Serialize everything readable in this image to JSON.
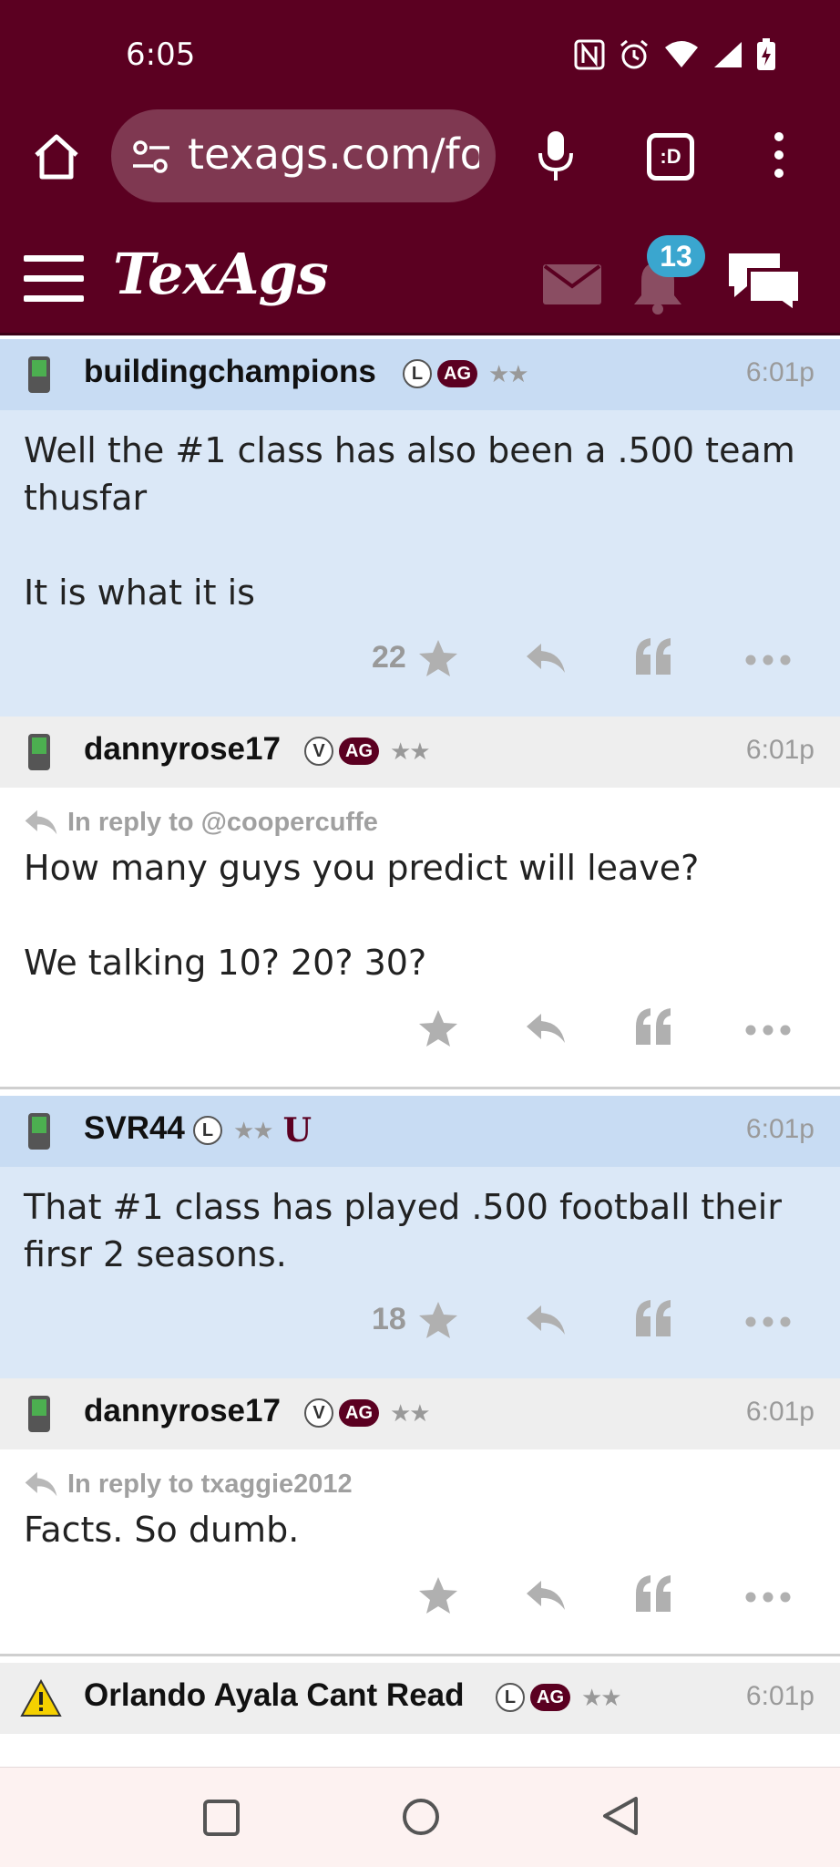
{
  "status_bar": {
    "time": "6:05",
    "icons": [
      "nfc-icon",
      "alarm-icon",
      "wifi-icon",
      "signal-icon",
      "battery-charging-icon"
    ]
  },
  "browser": {
    "url_main": "texags.com/for",
    "tabs_label": ":D"
  },
  "site": {
    "logo": "TexAgs",
    "notifications_count": "13"
  },
  "colors": {
    "maroon": "#5b0021",
    "highlight_body": "#dbe8f7",
    "highlight_head": "#c8dcf3",
    "badge_blue": "#3aa6cf"
  },
  "posts": [
    {
      "username": "buildingchampions",
      "badge_letter": "L",
      "badge_ag": "AG",
      "stars": "★★",
      "time": "6:01p",
      "line1": "Well the #1 class has also been a .500 team thusfar",
      "line2": "It is what it is",
      "star_count": "22"
    },
    {
      "username": "dannyrose17",
      "badge_letter": "V",
      "badge_ag": "AG",
      "stars": "★★",
      "time": "6:01p",
      "reply_to": "In reply to @coopercuffe",
      "line1": "How many guys you predict will leave?",
      "line2": "We talking 10? 20? 30?"
    },
    {
      "username": "SVR44",
      "badge_letter": "L",
      "stars": "★★",
      "u_icon": "U",
      "time": "6:01p",
      "line1": "That #1 class has played .500 football their firsr 2 seasons.",
      "star_count": "18"
    },
    {
      "username": "dannyrose17",
      "badge_letter": "V",
      "badge_ag": "AG",
      "stars": "★★",
      "time": "6:01p",
      "reply_to": "In reply to txaggie2012",
      "line1": "Facts. So dumb."
    },
    {
      "username": "Orlando Ayala Cant Read",
      "badge_letter": "L",
      "badge_ag": "AG",
      "stars": "★★",
      "time": "6:01p"
    }
  ]
}
